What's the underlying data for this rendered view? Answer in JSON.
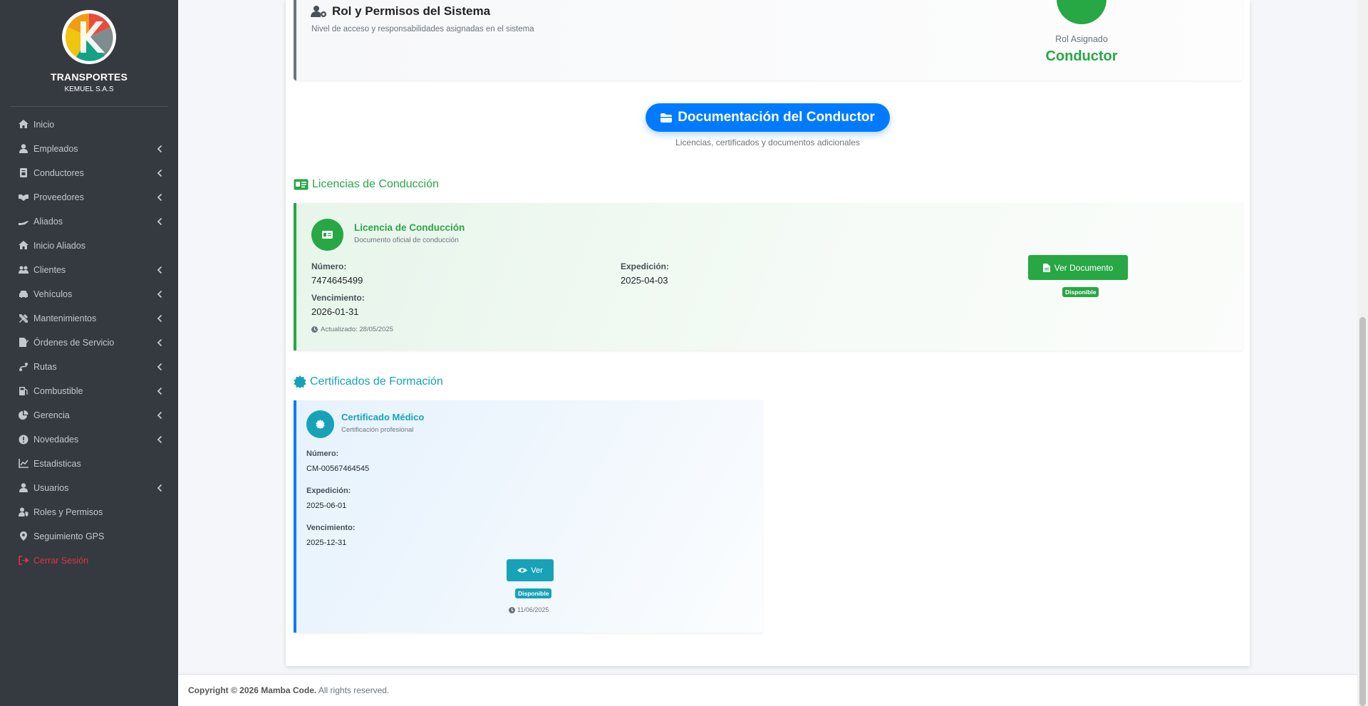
{
  "brand": {
    "title": "TRANSPORTES",
    "subtitle": "KEMUEL S.A.S"
  },
  "sidebar": {
    "items": [
      {
        "label": "Inicio",
        "icon": "home-icon",
        "chevron": false
      },
      {
        "label": "Empleados",
        "icon": "user-tie-icon",
        "chevron": true
      },
      {
        "label": "Conductores",
        "icon": "id-badge-icon",
        "chevron": true
      },
      {
        "label": "Proveedores",
        "icon": "handshake-icon",
        "chevron": true
      },
      {
        "label": "Aliados",
        "icon": "hand-holding-icon",
        "chevron": true
      },
      {
        "label": "Inicio Aliados",
        "icon": "home-icon",
        "chevron": false
      },
      {
        "label": "Clientes",
        "icon": "users-icon",
        "chevron": true
      },
      {
        "label": "Vehículos",
        "icon": "car-icon",
        "chevron": true
      },
      {
        "label": "Mantenimientos",
        "icon": "tools-icon",
        "chevron": true
      },
      {
        "label": "Órdenes de Servicio",
        "icon": "file-signature-icon",
        "chevron": true
      },
      {
        "label": "Rutas",
        "icon": "route-icon",
        "chevron": true
      },
      {
        "label": "Combustible",
        "icon": "gas-pump-icon",
        "chevron": true
      },
      {
        "label": "Gerencia",
        "icon": "chart-pie-icon",
        "chevron": true
      },
      {
        "label": "Novedades",
        "icon": "exclamation-circle-icon",
        "chevron": true
      },
      {
        "label": "Estadisticas",
        "icon": "chart-line-icon",
        "chevron": false
      },
      {
        "label": "Usuarios",
        "icon": "user-icon",
        "chevron": true
      },
      {
        "label": "Roles y Permisos",
        "icon": "user-shield-icon",
        "chevron": false
      },
      {
        "label": "Seguimiento GPS",
        "icon": "map-marker-icon",
        "chevron": false
      }
    ],
    "logout": "Cerrar Sesión"
  },
  "role": {
    "title": "Rol y Permisos del Sistema",
    "description": "Nivel de acceso y responsabilidades asignadas en el sistema",
    "label": "Rol Asignado",
    "value": "Conductor"
  },
  "documents": {
    "button": "Documentación del Conductor",
    "subtitle": "Licencias, certificados y documentos adicionales"
  },
  "licenses": {
    "section_title": "Licencias de Conducción",
    "card": {
      "name": "Licencia de Conducción",
      "subtitle": "Documento oficial de conducción",
      "numero_label": "Número:",
      "numero": "7474645499",
      "expedicion_label": "Expedición:",
      "expedicion": "2025-04-03",
      "vencimiento_label": "Vencimiento:",
      "vencimiento": "2026-01-31",
      "updated": "Actualizado: 28/05/2025",
      "button": "Ver Documento",
      "status": "Disponible"
    }
  },
  "certificates": {
    "section_title": "Certificados de Formación",
    "card": {
      "name": "Certificado Médico",
      "subtitle": "Certificación profesional",
      "numero_label": "Número:",
      "numero": "CM-00567464545",
      "expedicion_label": "Expedición:",
      "expedicion": "2025-06-01",
      "vencimiento_label": "Vencimiento:",
      "vencimiento": "2025-12-31",
      "button": "Ver",
      "status": "Disponible",
      "date": "11/06/2025"
    }
  },
  "footer": {
    "copyright": "Copyright © 2026 Mamba Code.",
    "rights": "All rights reserved."
  },
  "colors": {
    "sidebar": "#343a40",
    "green": "#28a745",
    "blue": "#007bff",
    "teal": "#17a2b8",
    "danger": "#dc3545"
  }
}
